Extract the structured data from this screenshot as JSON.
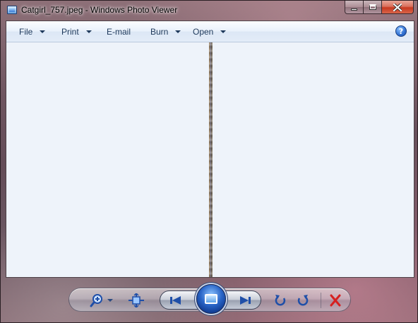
{
  "window": {
    "title": "Catgirl_757.jpeg - Windows Photo Viewer"
  },
  "caption_buttons": {
    "minimize": "minimize",
    "maximize": "maximize",
    "close": "close"
  },
  "menu": {
    "items": [
      {
        "label": "File",
        "has_dropdown": true
      },
      {
        "label": "Print",
        "has_dropdown": true
      },
      {
        "label": "E-mail",
        "has_dropdown": false
      },
      {
        "label": "Burn",
        "has_dropdown": true
      },
      {
        "label": "Open",
        "has_dropdown": true
      }
    ],
    "help_glyph": "?"
  },
  "controls": {
    "zoom": "zoom-icon",
    "actual_size": "actual-size-icon",
    "previous": "previous-icon",
    "slideshow": "slideshow-icon",
    "next": "next-icon",
    "rotate_ccw": "rotate-counterclockwise-icon",
    "rotate_cw": "rotate-clockwise-icon",
    "delete": "delete-icon"
  },
  "colors": {
    "menu_text": "#1e395b",
    "viewer_background": "#eef3fa",
    "delete_red": "#d62020",
    "accent_blue": "#2a66c8"
  }
}
